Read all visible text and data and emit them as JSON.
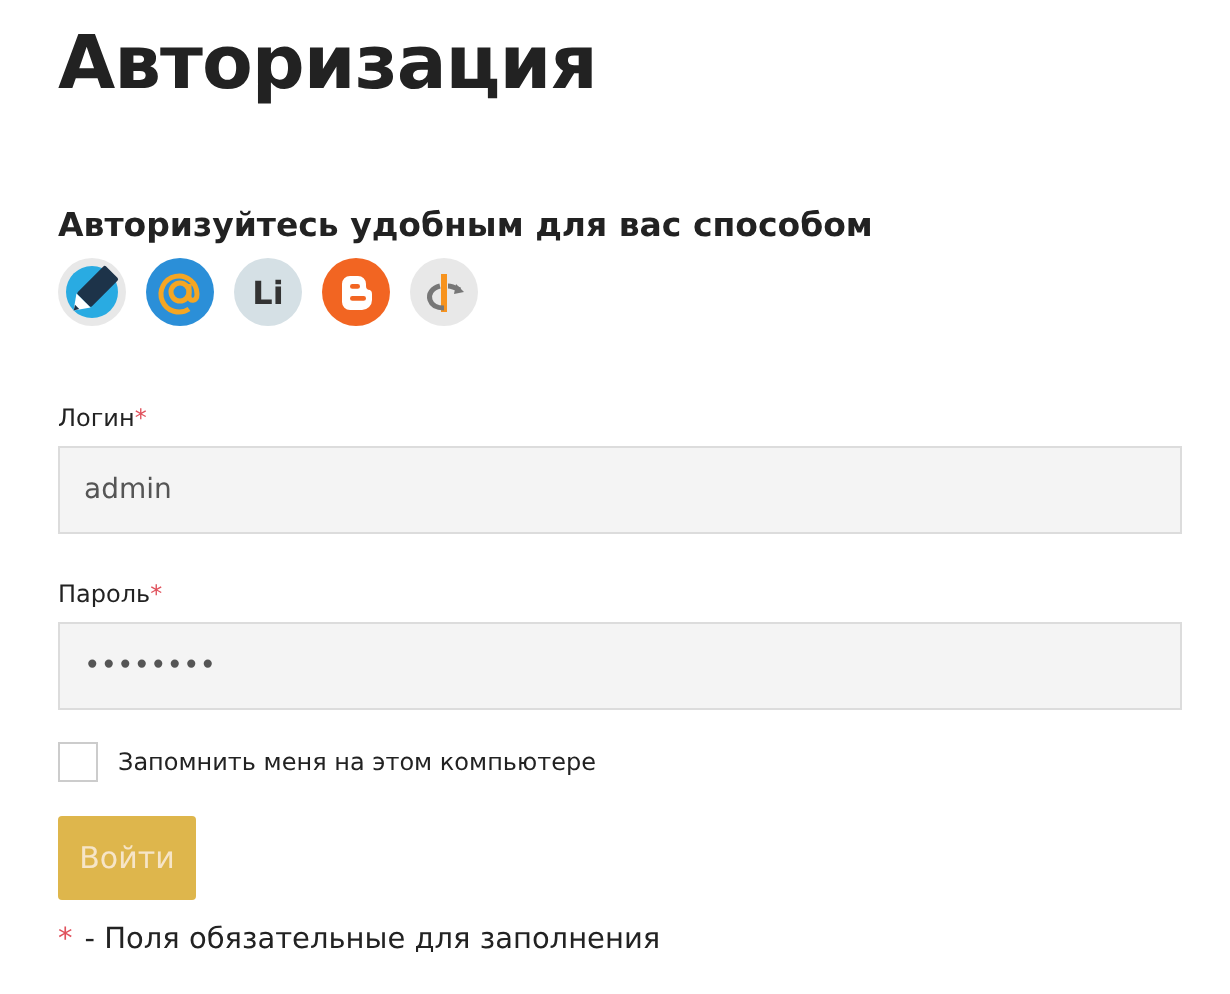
{
  "title": "Авторизация",
  "subtitle": "Авторизуйтесь удобным для вас способом",
  "providers": [
    {
      "kind": "pencil"
    },
    {
      "kind": "mail"
    },
    {
      "kind": "letters",
      "text": "Li"
    },
    {
      "kind": "blog"
    },
    {
      "kind": "openid"
    }
  ],
  "fields": [
    {
      "label": "Логин",
      "required_mark": "*",
      "value": "admin"
    },
    {
      "label": "Пароль",
      "required_mark": "*",
      "value": "••••••••"
    }
  ],
  "remember": {
    "label": "Запомнить меня на этом компьютере",
    "checked": false
  },
  "submit": "Войти",
  "note": {
    "mark": "*",
    "text": "- Поля обязательные для заполнения"
  }
}
